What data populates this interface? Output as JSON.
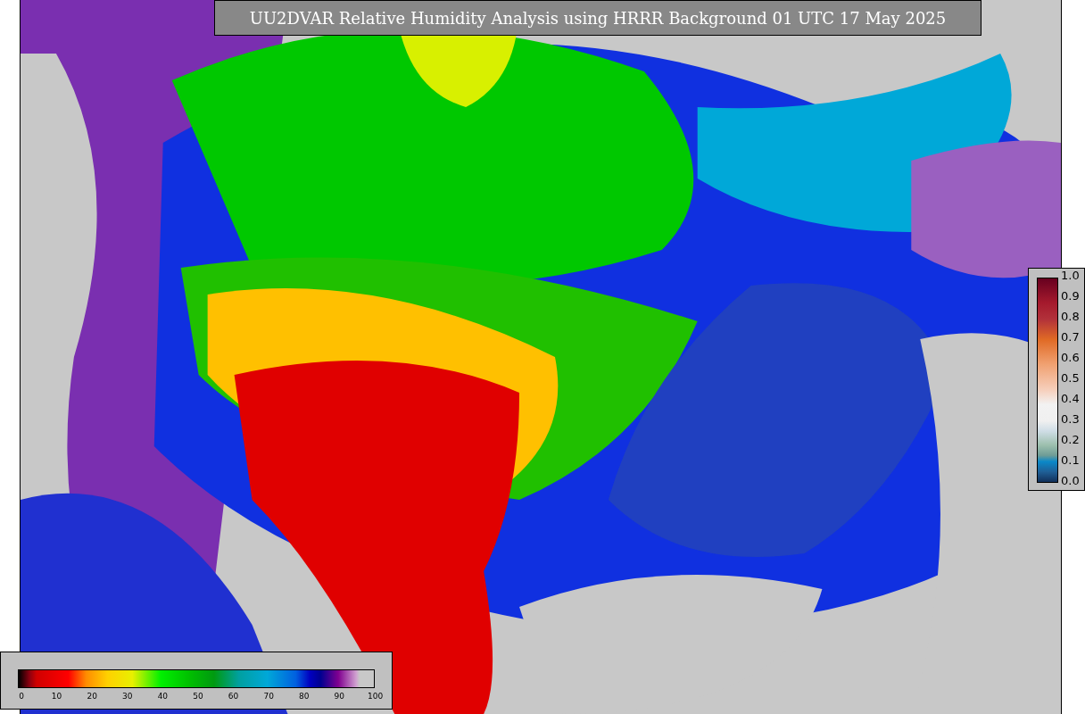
{
  "title": "UU2DVAR Relative Humidity Analysis using HRRR Background 01 UTC 17 May 2025",
  "vertical_colorbar": {
    "ticks": [
      "1.0",
      "0.9",
      "0.8",
      "0.7",
      "0.6",
      "0.5",
      "0.4",
      "0.3",
      "0.2",
      "0.1",
      "0.0"
    ]
  },
  "horizontal_colorbar": {
    "ticks": [
      "0",
      "10",
      "20",
      "30",
      "40",
      "50",
      "60",
      "70",
      "80",
      "90",
      "100"
    ]
  }
}
